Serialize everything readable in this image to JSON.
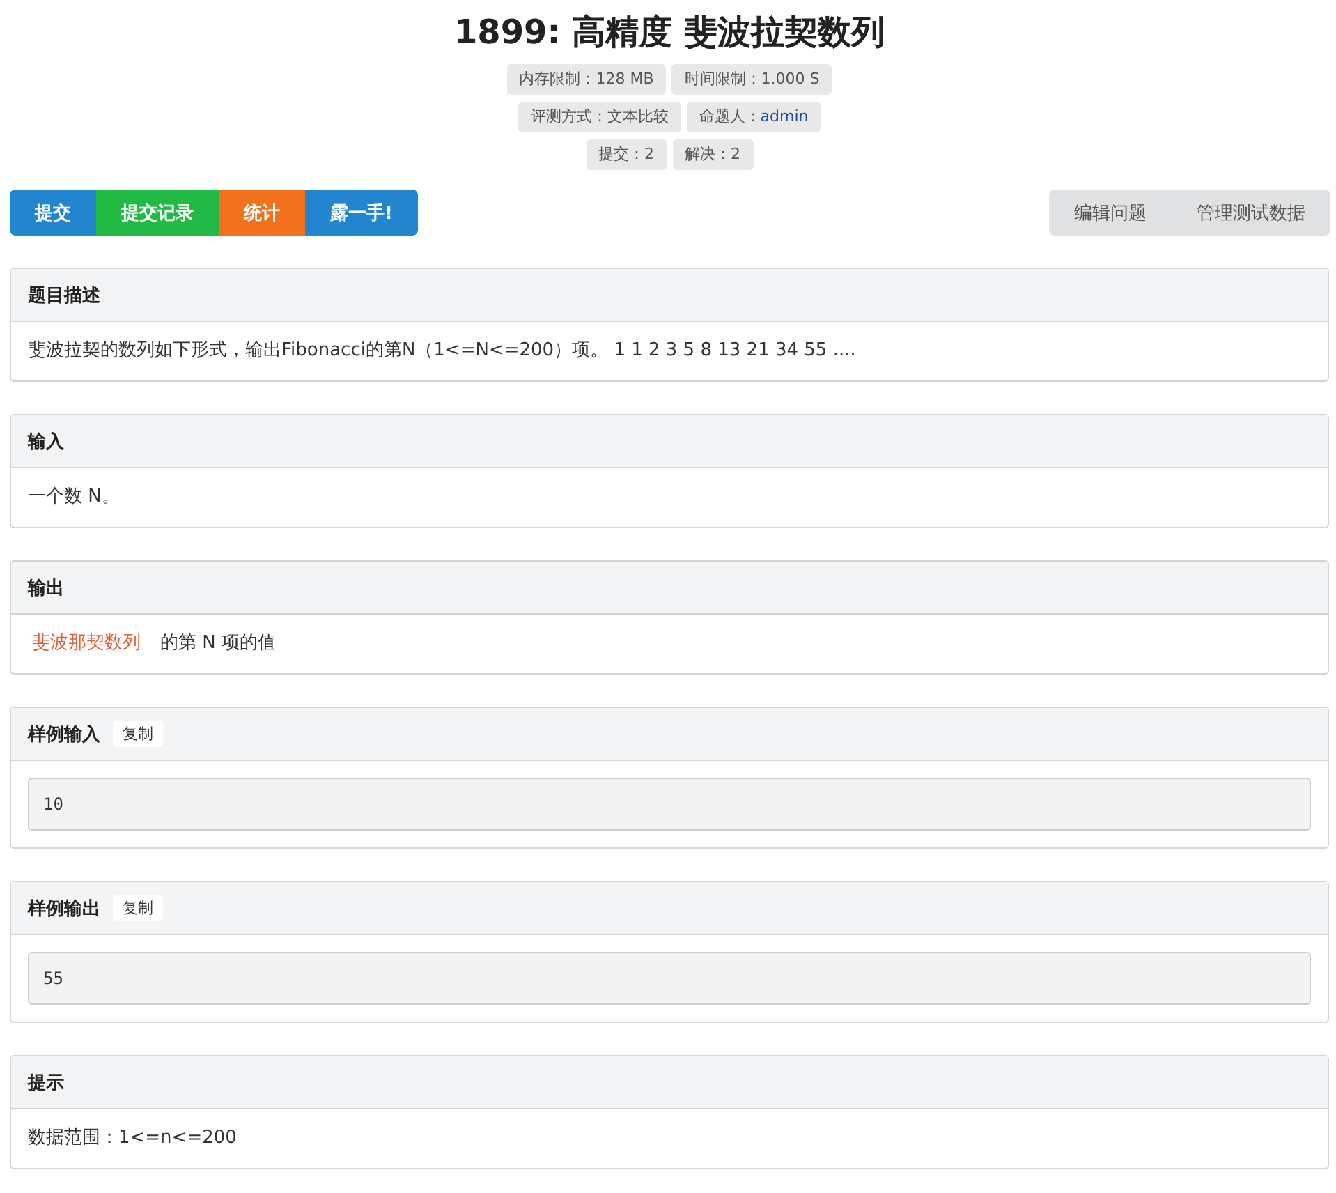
{
  "title": "1899: 高精度 斐波拉契数列",
  "meta_rows": [
    [
      {
        "label": "内存限制：",
        "value": "128 MB",
        "link": false
      },
      {
        "label": "时间限制：",
        "value": "1.000 S",
        "link": false
      }
    ],
    [
      {
        "label": "评测方式：",
        "value": "文本比较",
        "link": false
      },
      {
        "label": "命题人：",
        "value": "admin",
        "link": true
      }
    ],
    [
      {
        "label": "提交：",
        "value": "2",
        "link": false
      },
      {
        "label": "解决：",
        "value": "2",
        "link": false
      }
    ]
  ],
  "action_buttons": [
    {
      "label": "提交",
      "color": "#2185d0"
    },
    {
      "label": "提交记录",
      "color": "#21ba45"
    },
    {
      "label": "统计",
      "color": "#f2711c"
    },
    {
      "label": "露一手!",
      "color": "#2185d0"
    }
  ],
  "admin_buttons": [
    "编辑问题",
    "管理测试数据"
  ],
  "sections": [
    {
      "kind": "text",
      "title": "题目描述",
      "body": [
        {
          "kind": "plain",
          "text": "斐波拉契的数列如下形式，输出Fibonacci的第N（1<=N<=200）项。 1 1 2 3 5 8 13 21 34 55 ...."
        }
      ]
    },
    {
      "kind": "text",
      "title": "输入",
      "body": [
        {
          "kind": "plain",
          "text": "一个数 N。"
        }
      ]
    },
    {
      "kind": "text",
      "title": "输出",
      "body": [
        {
          "kind": "highlight",
          "text": "斐波那契数列"
        },
        {
          "kind": "plain",
          "text": "的第 N 项的值"
        }
      ]
    },
    {
      "kind": "sample",
      "title": "样例输入",
      "copy": "复制",
      "code": "10"
    },
    {
      "kind": "sample",
      "title": "样例输出",
      "copy": "复制",
      "code": "55"
    },
    {
      "kind": "text",
      "title": "提示",
      "body": [
        {
          "kind": "plain",
          "text": "数据范围：1<=n<=200"
        }
      ]
    }
  ]
}
